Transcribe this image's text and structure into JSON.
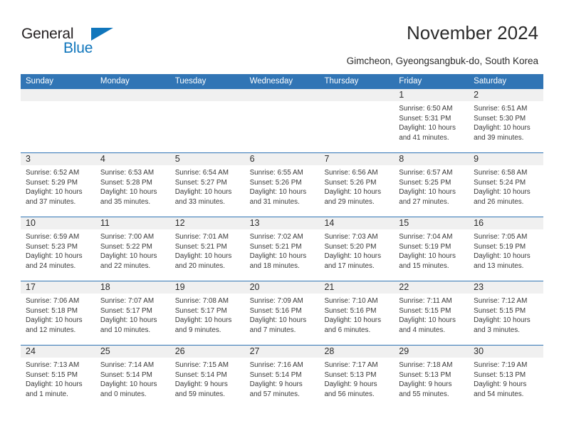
{
  "brand": {
    "line1": "General",
    "line2": "Blue",
    "triangle_color": "#1076bc"
  },
  "header": {
    "title": "November 2024",
    "subtitle": "Gimcheon, Gyeongsangbuk-do, South Korea"
  },
  "theme": {
    "header_blue": "#3175b5",
    "daynum_band": "#f0f0f0",
    "text": "#2b2b2b"
  },
  "weekdays": [
    "Sunday",
    "Monday",
    "Tuesday",
    "Wednesday",
    "Thursday",
    "Friday",
    "Saturday"
  ],
  "weeks": [
    [
      {
        "day": "",
        "sunrise": "",
        "sunset": "",
        "daylight": ""
      },
      {
        "day": "",
        "sunrise": "",
        "sunset": "",
        "daylight": ""
      },
      {
        "day": "",
        "sunrise": "",
        "sunset": "",
        "daylight": ""
      },
      {
        "day": "",
        "sunrise": "",
        "sunset": "",
        "daylight": ""
      },
      {
        "day": "",
        "sunrise": "",
        "sunset": "",
        "daylight": ""
      },
      {
        "day": "1",
        "sunrise": "Sunrise: 6:50 AM",
        "sunset": "Sunset: 5:31 PM",
        "daylight": "Daylight: 10 hours and 41 minutes."
      },
      {
        "day": "2",
        "sunrise": "Sunrise: 6:51 AM",
        "sunset": "Sunset: 5:30 PM",
        "daylight": "Daylight: 10 hours and 39 minutes."
      }
    ],
    [
      {
        "day": "3",
        "sunrise": "Sunrise: 6:52 AM",
        "sunset": "Sunset: 5:29 PM",
        "daylight": "Daylight: 10 hours and 37 minutes."
      },
      {
        "day": "4",
        "sunrise": "Sunrise: 6:53 AM",
        "sunset": "Sunset: 5:28 PM",
        "daylight": "Daylight: 10 hours and 35 minutes."
      },
      {
        "day": "5",
        "sunrise": "Sunrise: 6:54 AM",
        "sunset": "Sunset: 5:27 PM",
        "daylight": "Daylight: 10 hours and 33 minutes."
      },
      {
        "day": "6",
        "sunrise": "Sunrise: 6:55 AM",
        "sunset": "Sunset: 5:26 PM",
        "daylight": "Daylight: 10 hours and 31 minutes."
      },
      {
        "day": "7",
        "sunrise": "Sunrise: 6:56 AM",
        "sunset": "Sunset: 5:26 PM",
        "daylight": "Daylight: 10 hours and 29 minutes."
      },
      {
        "day": "8",
        "sunrise": "Sunrise: 6:57 AM",
        "sunset": "Sunset: 5:25 PM",
        "daylight": "Daylight: 10 hours and 27 minutes."
      },
      {
        "day": "9",
        "sunrise": "Sunrise: 6:58 AM",
        "sunset": "Sunset: 5:24 PM",
        "daylight": "Daylight: 10 hours and 26 minutes."
      }
    ],
    [
      {
        "day": "10",
        "sunrise": "Sunrise: 6:59 AM",
        "sunset": "Sunset: 5:23 PM",
        "daylight": "Daylight: 10 hours and 24 minutes."
      },
      {
        "day": "11",
        "sunrise": "Sunrise: 7:00 AM",
        "sunset": "Sunset: 5:22 PM",
        "daylight": "Daylight: 10 hours and 22 minutes."
      },
      {
        "day": "12",
        "sunrise": "Sunrise: 7:01 AM",
        "sunset": "Sunset: 5:21 PM",
        "daylight": "Daylight: 10 hours and 20 minutes."
      },
      {
        "day": "13",
        "sunrise": "Sunrise: 7:02 AM",
        "sunset": "Sunset: 5:21 PM",
        "daylight": "Daylight: 10 hours and 18 minutes."
      },
      {
        "day": "14",
        "sunrise": "Sunrise: 7:03 AM",
        "sunset": "Sunset: 5:20 PM",
        "daylight": "Daylight: 10 hours and 17 minutes."
      },
      {
        "day": "15",
        "sunrise": "Sunrise: 7:04 AM",
        "sunset": "Sunset: 5:19 PM",
        "daylight": "Daylight: 10 hours and 15 minutes."
      },
      {
        "day": "16",
        "sunrise": "Sunrise: 7:05 AM",
        "sunset": "Sunset: 5:19 PM",
        "daylight": "Daylight: 10 hours and 13 minutes."
      }
    ],
    [
      {
        "day": "17",
        "sunrise": "Sunrise: 7:06 AM",
        "sunset": "Sunset: 5:18 PM",
        "daylight": "Daylight: 10 hours and 12 minutes."
      },
      {
        "day": "18",
        "sunrise": "Sunrise: 7:07 AM",
        "sunset": "Sunset: 5:17 PM",
        "daylight": "Daylight: 10 hours and 10 minutes."
      },
      {
        "day": "19",
        "sunrise": "Sunrise: 7:08 AM",
        "sunset": "Sunset: 5:17 PM",
        "daylight": "Daylight: 10 hours and 9 minutes."
      },
      {
        "day": "20",
        "sunrise": "Sunrise: 7:09 AM",
        "sunset": "Sunset: 5:16 PM",
        "daylight": "Daylight: 10 hours and 7 minutes."
      },
      {
        "day": "21",
        "sunrise": "Sunrise: 7:10 AM",
        "sunset": "Sunset: 5:16 PM",
        "daylight": "Daylight: 10 hours and 6 minutes."
      },
      {
        "day": "22",
        "sunrise": "Sunrise: 7:11 AM",
        "sunset": "Sunset: 5:15 PM",
        "daylight": "Daylight: 10 hours and 4 minutes."
      },
      {
        "day": "23",
        "sunrise": "Sunrise: 7:12 AM",
        "sunset": "Sunset: 5:15 PM",
        "daylight": "Daylight: 10 hours and 3 minutes."
      }
    ],
    [
      {
        "day": "24",
        "sunrise": "Sunrise: 7:13 AM",
        "sunset": "Sunset: 5:15 PM",
        "daylight": "Daylight: 10 hours and 1 minute."
      },
      {
        "day": "25",
        "sunrise": "Sunrise: 7:14 AM",
        "sunset": "Sunset: 5:14 PM",
        "daylight": "Daylight: 10 hours and 0 minutes."
      },
      {
        "day": "26",
        "sunrise": "Sunrise: 7:15 AM",
        "sunset": "Sunset: 5:14 PM",
        "daylight": "Daylight: 9 hours and 59 minutes."
      },
      {
        "day": "27",
        "sunrise": "Sunrise: 7:16 AM",
        "sunset": "Sunset: 5:14 PM",
        "daylight": "Daylight: 9 hours and 57 minutes."
      },
      {
        "day": "28",
        "sunrise": "Sunrise: 7:17 AM",
        "sunset": "Sunset: 5:13 PM",
        "daylight": "Daylight: 9 hours and 56 minutes."
      },
      {
        "day": "29",
        "sunrise": "Sunrise: 7:18 AM",
        "sunset": "Sunset: 5:13 PM",
        "daylight": "Daylight: 9 hours and 55 minutes."
      },
      {
        "day": "30",
        "sunrise": "Sunrise: 7:19 AM",
        "sunset": "Sunset: 5:13 PM",
        "daylight": "Daylight: 9 hours and 54 minutes."
      }
    ]
  ]
}
